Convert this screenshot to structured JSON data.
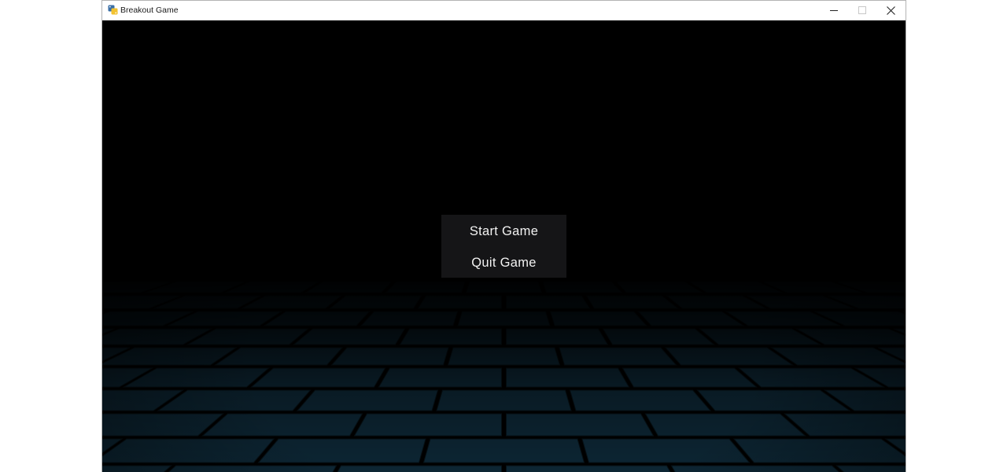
{
  "window": {
    "title": "Breakout Game",
    "controls": {
      "minimize": "minimize-icon",
      "maximize": "maximize-icon",
      "close": "close-icon"
    }
  },
  "menu": {
    "start_label": "Start Game",
    "quit_label": "Quit Game"
  },
  "colors": {
    "background": "#000000",
    "floor_tile": "#0d2634",
    "menu_panel": "#151517",
    "menu_text": "#f2f2f2"
  }
}
